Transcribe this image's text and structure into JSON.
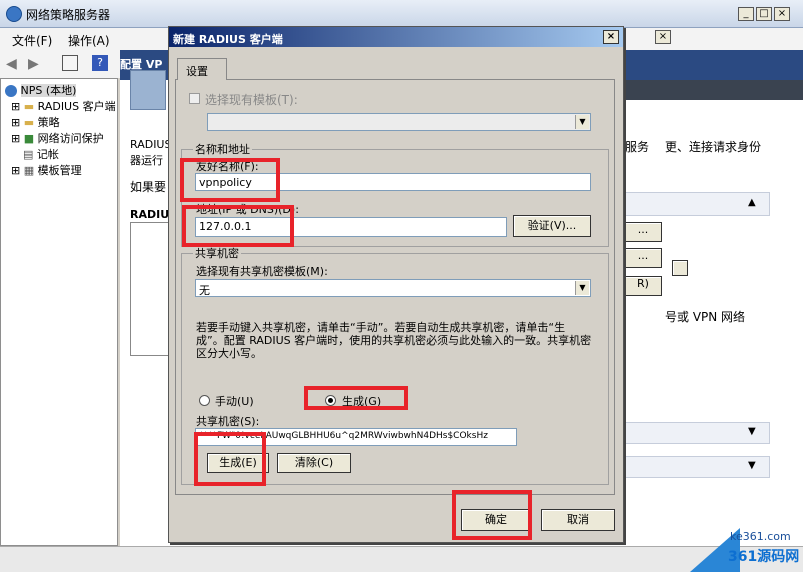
{
  "window": {
    "title": "网络策略服务器"
  },
  "menu": {
    "file": "文件(F)",
    "action": "操作(A)"
  },
  "tree": {
    "root": "NPS (本地)",
    "items": [
      "RADIUS 客户端",
      "策略",
      "网络访问保护",
      "记帐",
      "模板管理"
    ]
  },
  "background": {
    "config_tab": "配置 VP",
    "text1": "RADIUS",
    "text2": "器运行",
    "text3": "如果要",
    "heading": "RADIUS",
    "right1": "服务",
    "right2": "更、连接请求身份",
    "right3": "号或 VPN 网络",
    "btn1": "...",
    "btn2": "...",
    "btn3": "R)"
  },
  "dialog": {
    "title": "新建 RADIUS 客户端",
    "tab": "设置",
    "template_check": "选择现有模板(T):",
    "group_name": "名称和地址",
    "friendly_label": "友好名称(F):",
    "friendly_value": "vpnpolicy",
    "address_label": "地址(IP 或 DNS)(D):",
    "address_value": "127.0.0.1",
    "verify_btn": "验证(V)...",
    "group_secret": "共享机密",
    "secret_template_label": "选择现有共享机密模板(M):",
    "secret_template_value": "无",
    "instructions": "若要手动键入共享机密，请单击“手动”。若要自动生成共享机密，请单击“生成”。配置 RADIUS 客户端时，使用的共享机密必须与此处输入的一致。共享机密区分大小写。",
    "radio_manual": "手动(U)",
    "radio_generate": "生成(G)",
    "secret_label": "共享机密(S):",
    "secret_value": "****FW\"0!vceLAUwqGLBHHU6u^q2MRWviwbwhN4DHs$COksHz",
    "generate_btn": "生成(E)",
    "clear_btn": "清除(C)",
    "ok_btn": "确定",
    "cancel_btn": "取消"
  },
  "watermark": {
    "site": "ke361.com",
    "brand": "361源码网"
  },
  "colors": {
    "highlight": "#e8232a",
    "dialog_title": "#0a246a"
  }
}
